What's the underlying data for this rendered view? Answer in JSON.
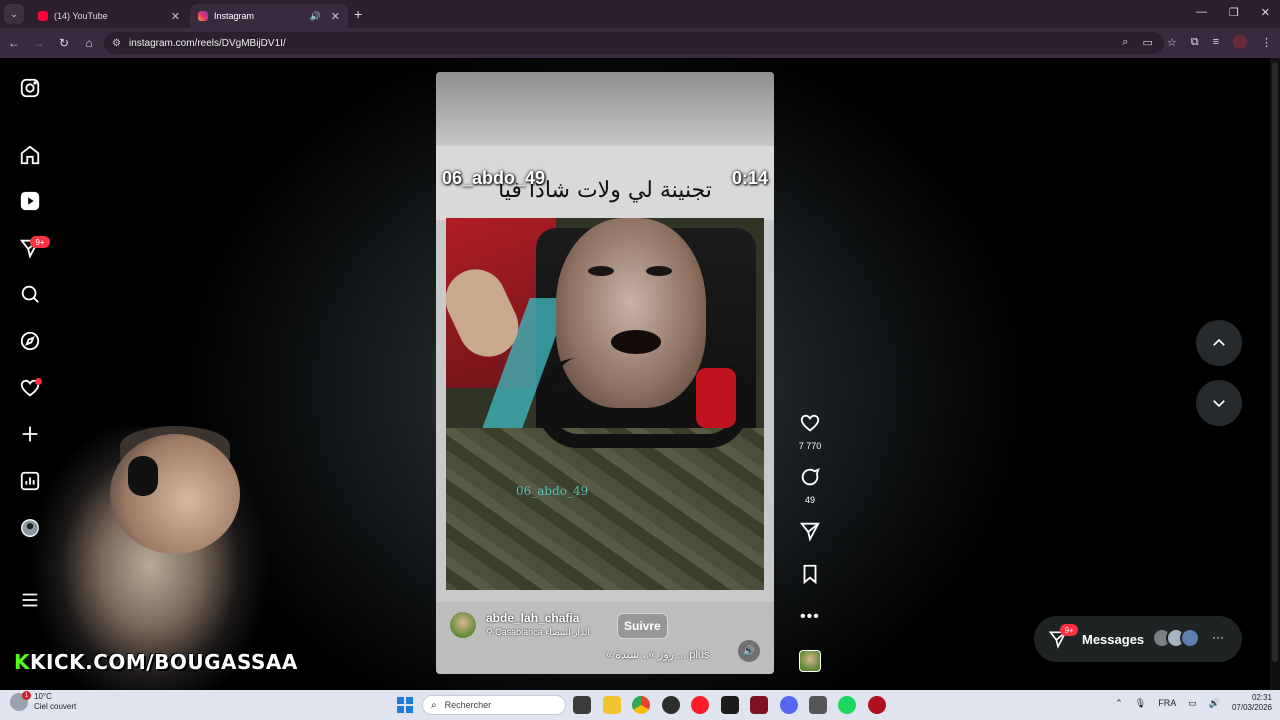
{
  "browser": {
    "tabs": [
      {
        "title": "(14) YouTube",
        "active": false,
        "favicon": "youtube-icon"
      },
      {
        "title": "Instagram",
        "active": true,
        "favicon": "instagram-icon"
      }
    ],
    "url": "instagram.com/reels/DVgMBijDV1I/"
  },
  "sidebar": {
    "notifications_badge": "9+"
  },
  "stream_overlay": {
    "prefix": "K",
    "text": "KICK.COM/BOUGASSAA"
  },
  "reel": {
    "overlay_user": "06_abdo_49",
    "overlay_time": "0:14",
    "arabic_caption": "تجنينة لي ولات شادّا فيا",
    "video_watermark": "06_abdo_49",
    "author": "abde_lah_chafia",
    "location": "Casablanca الدار البيضاء",
    "follow_label": "Suivre",
    "caption": "« روز ».، سيدة ... plus",
    "likes": "7 770",
    "comments": "49"
  },
  "messages": {
    "label": "Messages",
    "badge": "9+"
  },
  "taskbar": {
    "weather_temp": "10°C",
    "weather_desc": "Ciel couvert",
    "weather_badge": "1",
    "search_placeholder": "Rechercher",
    "lang": "FRA",
    "time": "02:31",
    "date": "07/03/2026"
  },
  "colors": {
    "instagram_red": "#ff3040",
    "kick_green": "#53fc18",
    "browser_chrome": "#3a2a3e"
  }
}
